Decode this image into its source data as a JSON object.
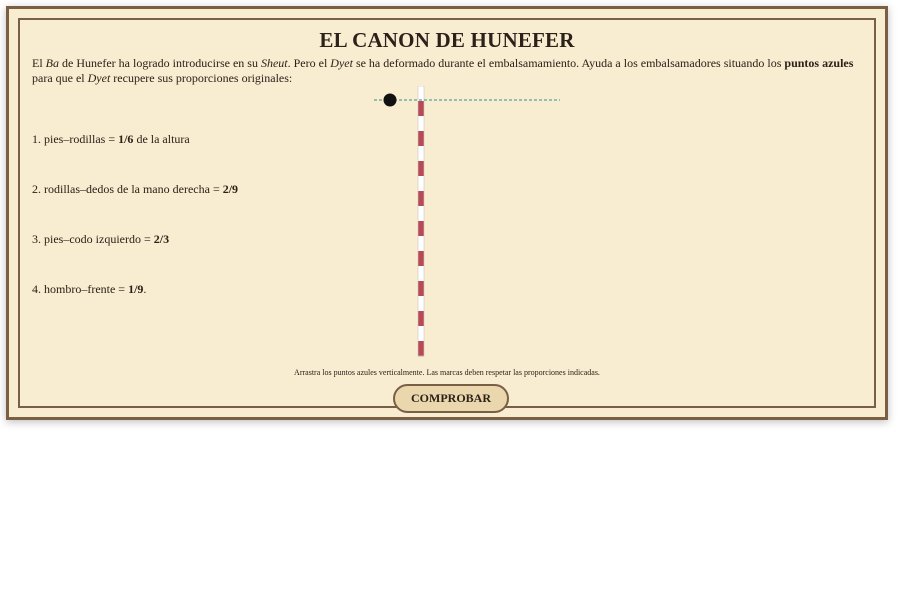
{
  "title": "EL CANON DE HUNEFER",
  "intro": {
    "p1": "El ",
    "ba": "Ba",
    "p2": " de Hunefer ha logrado introducirse en su ",
    "sheut": "Sheut",
    "p3": ". Pero el ",
    "dyet1": "Dyet",
    "p4": " se ha deformado durante el embalsamamiento. Ayuda a los embalsamadores situando los ",
    "points": "puntos azules",
    "p5": " para que el ",
    "dyet2": "Dyet",
    "p6": " recupere sus proporciones originales:"
  },
  "rules": [
    {
      "text": "1. pies–rodillas = ",
      "value": "1/6",
      "suffix": " de la altura"
    },
    {
      "text": "2. rodillas–dedos de la mano derecha = ",
      "value": "2/9",
      "suffix": ""
    },
    {
      "text": "3. pies–codo izquierdo = ",
      "value": "2/3",
      "suffix": ""
    },
    {
      "text": "4. hombro–frente = ",
      "value": "1/9",
      "suffix": "."
    }
  ],
  "pole": {
    "stripe_colors": [
      "#b84a55",
      "#ffffff"
    ],
    "stripe_count": 18
  },
  "marker": {
    "color": "#111111",
    "guide_color": "#2f8f8f"
  },
  "hint": "Arrastra los puntos azules verticalmente. Las marcas deben respetar las proporciones indicadas.",
  "button": {
    "label": "COMPROBAR"
  }
}
